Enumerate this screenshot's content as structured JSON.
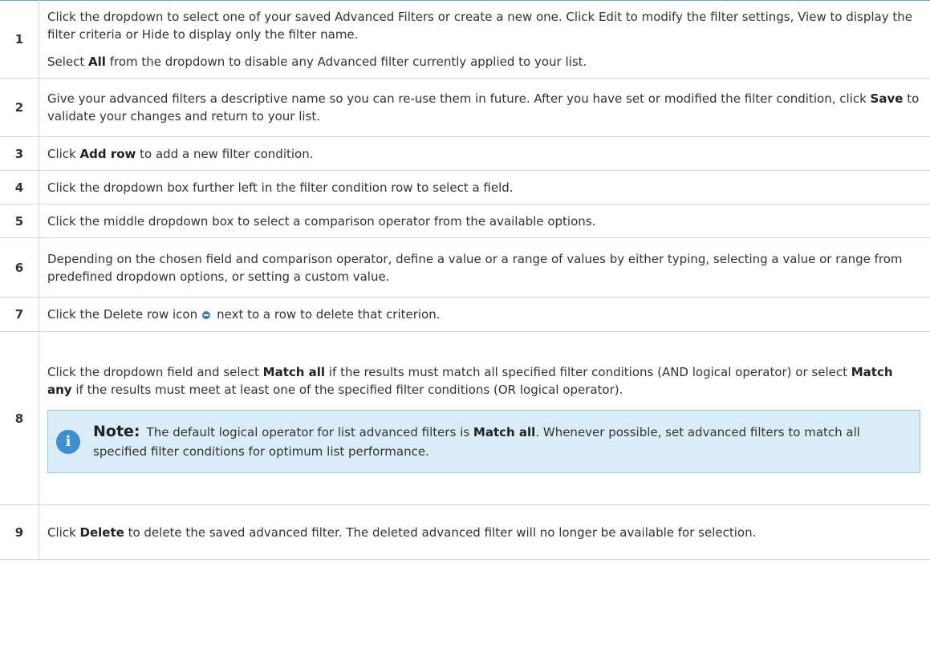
{
  "steps": [
    {
      "num": "1",
      "p1": "Click the dropdown to select one of your saved Advanced Filters or create a new one. Click Edit to modify the filter settings, View to display the filter criteria or Hide to display only the filter name.",
      "p2a": "Select ",
      "p2b": "All",
      "p2c": " from the dropdown to disable any Advanced filter currently applied to your list."
    },
    {
      "num": "2",
      "a": "Give your advanced filters a descriptive name so you can re-use them in future. After you have set or modified the filter condition, click ",
      "b": "Save",
      "c": " to validate your changes and return to your list."
    },
    {
      "num": "3",
      "a": "Click ",
      "b": "Add row",
      "c": " to add a new filter condition."
    },
    {
      "num": "4",
      "a": "Click the dropdown box further left in the filter condition row to select a field."
    },
    {
      "num": "5",
      "a": "Click the middle dropdown box to select a comparison operator from the available options."
    },
    {
      "num": "6",
      "a": "Depending on the chosen field and comparison operator, define a value or a range of values by either typing, selecting a value or range from predefined dropdown options, or setting a custom value."
    },
    {
      "num": "7",
      "a": "Click the Delete row icon",
      "c": "next to a row to delete that criterion."
    },
    {
      "num": "8",
      "a": "Click the dropdown field and select ",
      "b": "Match all",
      "c": " if the results must match all specified filter conditions (AND logical operator) or select ",
      "d": "Match any",
      "e": " if the results must meet at least one of the specified filter conditions (OR logical operator).",
      "note": {
        "icon_glyph": "i",
        "title": "Note:",
        "a": "The default logical operator for list advanced filters is ",
        "b": "Match all",
        "c": ". Whenever possible, set advanced filters to match all specified filter conditions for optimum list performance."
      }
    },
    {
      "num": "9",
      "a": "Click ",
      "b": "Delete",
      "c": " to delete the saved advanced filter. The deleted advanced filter will no longer be available for selection."
    }
  ]
}
